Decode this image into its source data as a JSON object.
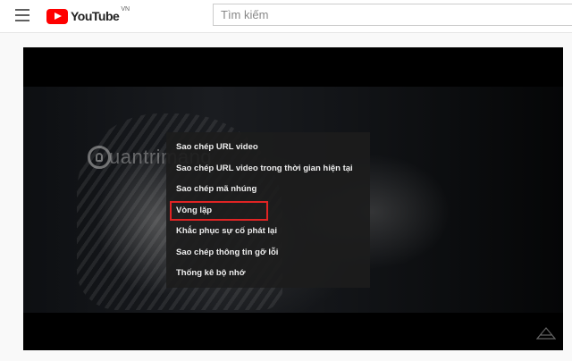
{
  "header": {
    "menu_icon": "hamburger-icon",
    "logo_text": "YouTube",
    "logo_region": "VN",
    "search_placeholder": "Tìm kiếm"
  },
  "player": {
    "watermark_text": "uantrimang",
    "context_menu": {
      "items": [
        {
          "label": "Sao chép URL video"
        },
        {
          "label": "Sao chép URL video trong thời gian hiện tại"
        },
        {
          "label": "Sao chép mã nhúng"
        },
        {
          "label": "Vòng lặp",
          "highlighted": true
        },
        {
          "label": "Khắc phục sự cố phát lại"
        },
        {
          "label": "Sao chép thông tin gỡ lỗi"
        },
        {
          "label": "Thống kê bộ nhớ"
        }
      ]
    },
    "colors": {
      "highlight_border": "#e02424",
      "menu_bg": "#1c1c1c",
      "brand_red": "#ff0000"
    }
  }
}
